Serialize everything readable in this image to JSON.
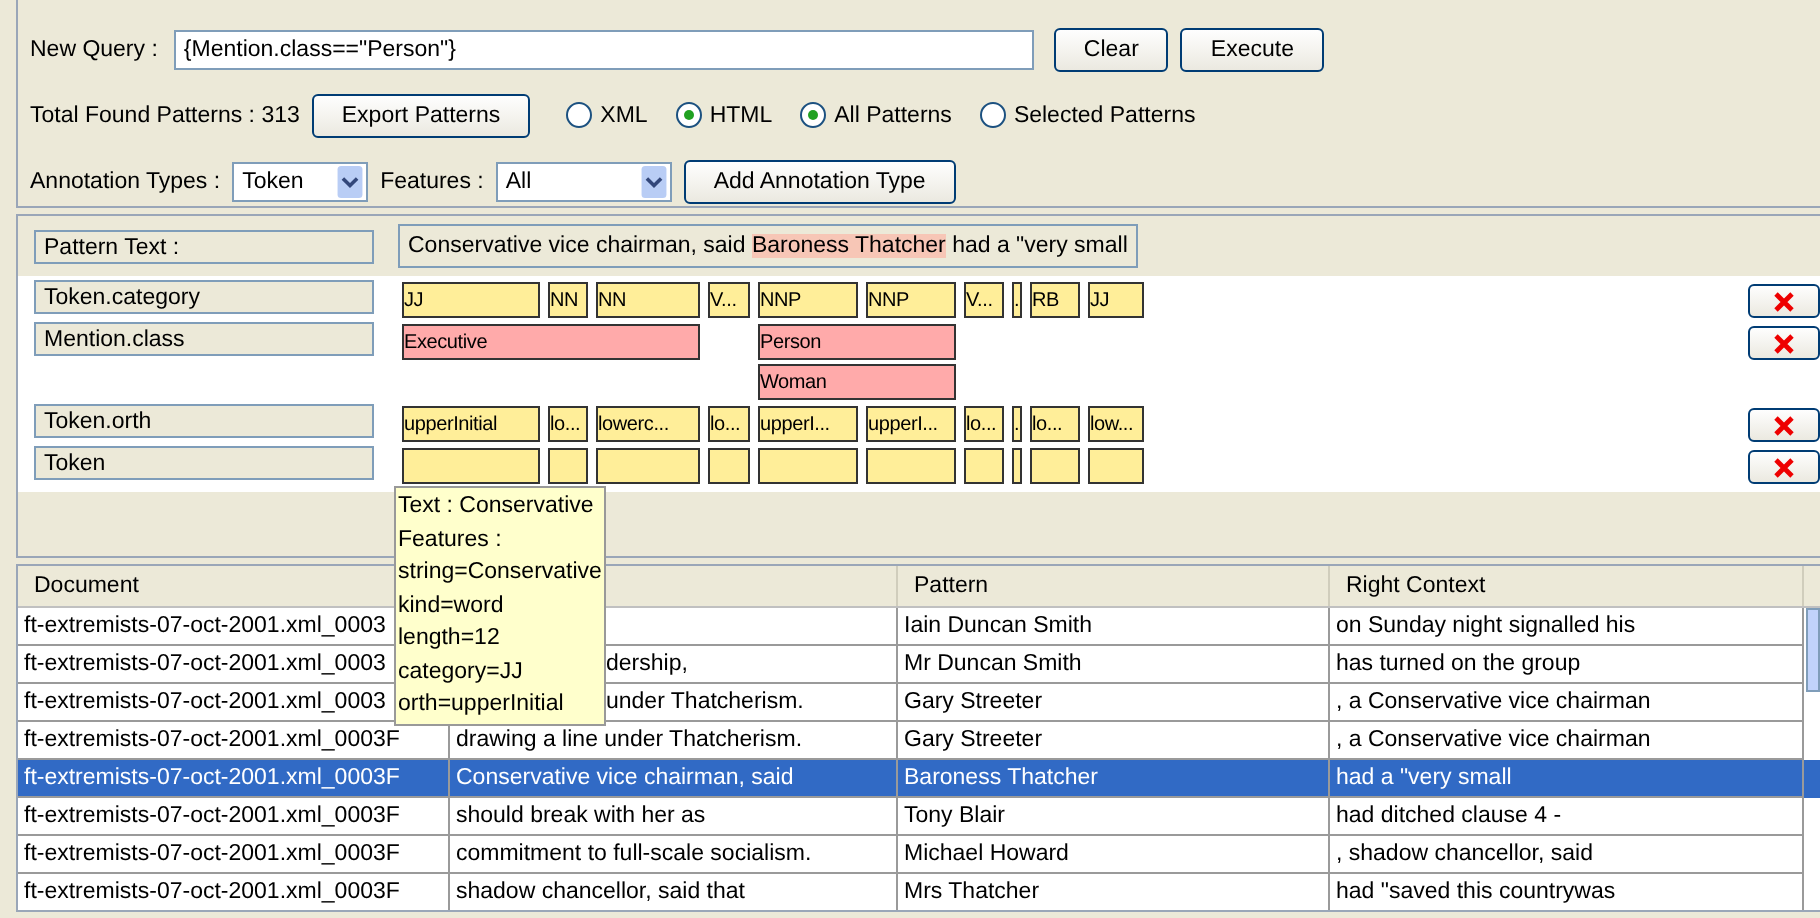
{
  "query": {
    "label": "New Query :",
    "value": "{Mention.class==\"Person\"}",
    "buttons": [
      "Clear",
      "Execute"
    ]
  },
  "results": {
    "total": "Total Found Patterns : 313",
    "export_button": "Export Patterns",
    "format_options": [
      {
        "label": "XML",
        "selected": false
      },
      {
        "label": "HTML",
        "selected": true
      }
    ],
    "scope_options": [
      {
        "label": "All Patterns",
        "selected": true
      },
      {
        "label": "Selected Patterns",
        "selected": false
      }
    ]
  },
  "annotation_filter": {
    "types_label": "Annotation Types :",
    "type_value": "Token",
    "features_label": "Features :",
    "features_value": "All",
    "add_button": "Add Annotation Type"
  },
  "pattern_text": {
    "label": "Pattern Text :",
    "before": "Conservative vice chairman, said ",
    "highlight": "Baroness Thatcher",
    "after": " had a \"very small"
  },
  "annotation_rows": [
    {
      "label": "Token.category",
      "color": "#ffee99",
      "lanes": [
        [
          {
            "kind": "tag",
            "label": "JJ"
          },
          {
            "kind": "tag",
            "label": "NN"
          },
          {
            "kind": "tag",
            "label": "NN"
          },
          {
            "kind": "tag",
            "label": "V..."
          },
          {
            "kind": "tag",
            "label": "NNP"
          },
          {
            "kind": "tag",
            "label": "NNP"
          },
          {
            "kind": "tag",
            "label": "V..."
          },
          {
            "kind": "tag",
            "label": "."
          },
          {
            "kind": "tag",
            "label": "RB"
          },
          {
            "kind": "tag",
            "label": "JJ"
          }
        ]
      ]
    },
    {
      "label": "Mention.class",
      "color": "#ffaaaa",
      "lanes": [
        [
          {
            "kind": "tag",
            "label": "Executive"
          },
          {
            "kind": "tag",
            "label": "Person"
          }
        ],
        [
          {
            "kind": "tag",
            "label": "Woman"
          }
        ]
      ]
    },
    {
      "label": "Token.orth",
      "color": "#ffee99",
      "lanes": [
        [
          {
            "kind": "tag",
            "label": "upperInitial"
          },
          {
            "kind": "tag",
            "label": "lo..."
          },
          {
            "kind": "tag",
            "label": "lowerc..."
          },
          {
            "kind": "tag",
            "label": "lo..."
          },
          {
            "kind": "tag",
            "label": "upperI..."
          },
          {
            "kind": "tag",
            "label": "upperI..."
          },
          {
            "kind": "tag",
            "label": "lo..."
          },
          {
            "kind": "tag",
            "label": "."
          },
          {
            "kind": "tag",
            "label": "lo..."
          },
          {
            "kind": "tag",
            "label": "low..."
          }
        ]
      ]
    },
    {
      "label": "Token",
      "color": "#ffee99",
      "lanes": [
        [
          {
            "kind": "blank"
          },
          {
            "kind": "blank"
          },
          {
            "kind": "blank"
          },
          {
            "kind": "blank"
          },
          {
            "kind": "blank"
          },
          {
            "kind": "blank"
          },
          {
            "kind": "blank"
          },
          {
            "kind": "blank"
          },
          {
            "kind": "blank"
          },
          {
            "kind": "blank"
          }
        ]
      ]
    }
  ],
  "tooltip": [
    "Text : Conservative",
    "Features :",
    "string=Conservative",
    "kind=word",
    "length=12",
    "category=JJ",
    "orth=upperInitial"
  ],
  "table": {
    "columns": [
      "Document",
      "",
      "Pattern",
      "Right Context"
    ],
    "rows": [
      {
        "selected": false,
        "cells": [
          "ft-extremists-07-oct-2001.xml_0003",
          "",
          "Iain Duncan Smith",
          "on Sunday night signalled his"
        ]
      },
      {
        "selected": false,
        "cells": [
          "ft-extremists-07-oct-2001.xml_0003",
          "dership,",
          "Mr Duncan Smith",
          "has turned on the group"
        ]
      },
      {
        "selected": false,
        "cells": [
          "ft-extremists-07-oct-2001.xml_0003",
          "under Thatcherism.",
          "Gary Streeter",
          ", a Conservative vice chairman"
        ]
      },
      {
        "selected": false,
        "cells": [
          "ft-extremists-07-oct-2001.xml_0003F",
          "drawing a line under Thatcherism.",
          "Gary Streeter",
          ", a Conservative vice chairman"
        ]
      },
      {
        "selected": true,
        "cells": [
          "ft-extremists-07-oct-2001.xml_0003F",
          "Conservative vice chairman, said",
          "Baroness Thatcher",
          "had a \"very small"
        ]
      },
      {
        "selected": false,
        "cells": [
          "ft-extremists-07-oct-2001.xml_0003F",
          "should break with her as",
          "Tony Blair",
          "had ditched clause 4 -"
        ]
      },
      {
        "selected": false,
        "cells": [
          "ft-extremists-07-oct-2001.xml_0003F",
          "commitment to full-scale socialism.",
          "Michael Howard",
          ", shadow chancellor, said"
        ]
      },
      {
        "selected": false,
        "cells": [
          "ft-extremists-07-oct-2001.xml_0003F",
          "shadow chancellor, said that",
          "Mrs Thatcher",
          "had \"saved this countrywas"
        ]
      }
    ]
  }
}
